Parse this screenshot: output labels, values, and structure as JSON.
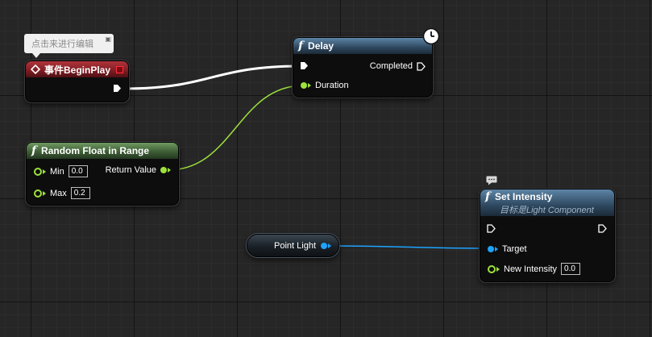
{
  "comment_bubble": {
    "text": "点击来进行编辑"
  },
  "begin_play": {
    "title": "事件BeginPlay",
    "header_color": "#8c2027"
  },
  "delay": {
    "title": "Delay",
    "completed_label": "Completed",
    "duration_label": "Duration",
    "header_color": "#3c5d7a"
  },
  "random_float": {
    "title": "Random Float in Range",
    "min_label": "Min",
    "min_value": "0.0",
    "max_label": "Max",
    "max_value": "0.2",
    "return_label": "Return Value",
    "header_color": "#4a6b40"
  },
  "point_light": {
    "label": "Point Light"
  },
  "set_intensity": {
    "title": "Set Intensity",
    "subtitle": "目标是Light Component",
    "target_label": "Target",
    "new_intensity_label": "New Intensity",
    "new_intensity_value": "0.0",
    "header_color": "#3c5d7a"
  },
  "colors": {
    "exec_wire": "#ffffff",
    "float_wire": "#9ee23c",
    "object_wire": "#1ea3ff",
    "graph_background": "#262626"
  },
  "icons": [
    "event-diamond-icon",
    "function-f-icon",
    "clock-icon",
    "comment-icon",
    "exec-pin-icon",
    "float-pin-icon",
    "object-pin-icon"
  ]
}
